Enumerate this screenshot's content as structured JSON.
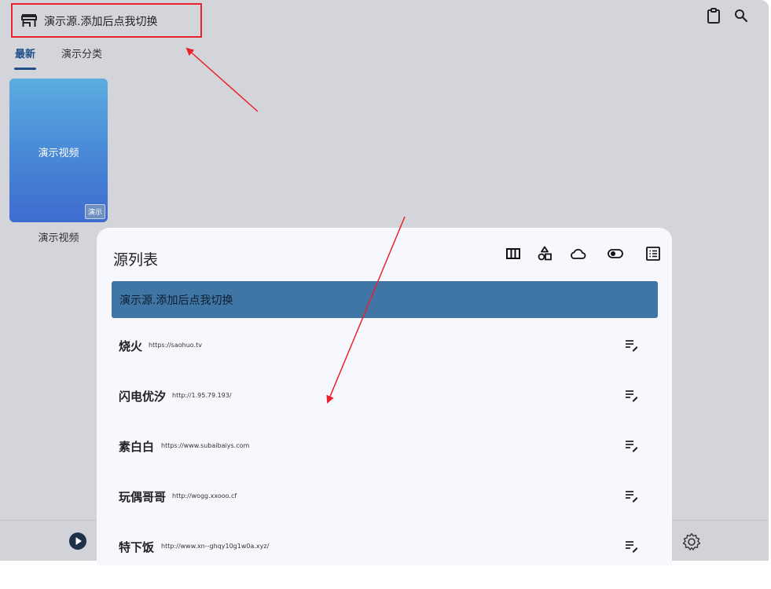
{
  "header": {
    "title": "演示源.添加后点我切换",
    "icons": [
      "store-icon",
      "clipboard-icon",
      "search-icon"
    ]
  },
  "tabs": [
    {
      "label": "最新",
      "active": true
    },
    {
      "label": "演示分类",
      "active": false
    }
  ],
  "video": {
    "card_text": "演示视频",
    "badge": "演示",
    "caption": "演示视频"
  },
  "sheet": {
    "title": "源列表",
    "icons": [
      "column-view-icon",
      "shapes-icon",
      "cloud-icon",
      "toggle-icon",
      "list-view-icon"
    ],
    "selected": "演示源.添加后点我切换",
    "sources": [
      {
        "name": "烧火",
        "url": "https://saohuo.tv"
      },
      {
        "name": "闪电优汐",
        "url": "http://1.95.79.193/"
      },
      {
        "name": "素白白",
        "url": "https://www.subaibaiys.com"
      },
      {
        "name": "玩偶哥哥",
        "url": "http://wogg.xxooo.cf"
      },
      {
        "name": "特下饭",
        "url": "http://www.xn--ghqy10g1w0a.xyz/"
      }
    ]
  },
  "bottom": {
    "icons": [
      "play-icon",
      "gear-icon"
    ]
  },
  "colors": {
    "accent": "#1e4f86",
    "selected_row": "#3f76a6",
    "annotation": "#e8232b"
  }
}
